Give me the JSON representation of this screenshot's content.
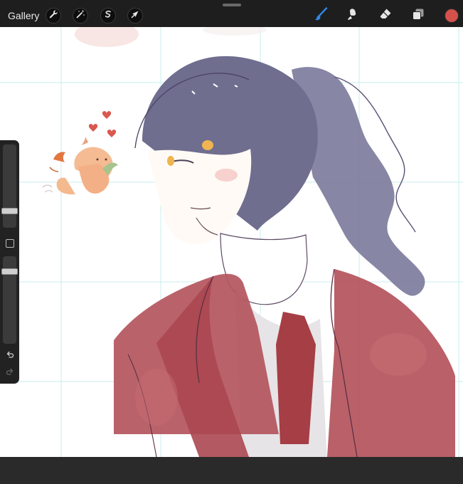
{
  "toolbar": {
    "gallery_label": "Gallery",
    "actions": [
      {
        "name": "wrench-icon"
      },
      {
        "name": "magic-wand-icon"
      },
      {
        "name": "selection-icon"
      },
      {
        "name": "transform-arrow-icon"
      }
    ],
    "tools": [
      {
        "name": "brush-icon",
        "active": true
      },
      {
        "name": "smudge-icon",
        "active": false
      },
      {
        "name": "eraser-icon",
        "active": false
      },
      {
        "name": "layers-icon",
        "active": false
      }
    ],
    "current_color": "#d4514c",
    "active_tool_color": "#2f86e8"
  },
  "sidebar": {
    "brush_size_level": 0.18,
    "opacity_level": 0.85
  },
  "canvas": {
    "background": "#ffffff",
    "grid_color": "#c8ecec"
  }
}
